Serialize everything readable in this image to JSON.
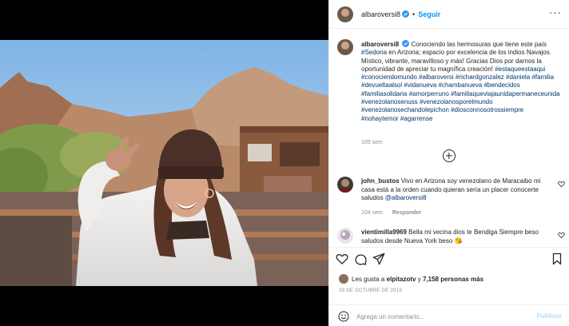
{
  "post": {
    "username": "albaroversi8",
    "follow_label": "Seguir",
    "more_icon": "more-options-icon",
    "photo_alt": "Woman in white coat and brown knit beanie making a peace sign in front of red rock mountains"
  },
  "caption": {
    "username": "albaroversi8",
    "text_plain": "Conociendo las hermosuras que tiene este país",
    "tag_sedona": "#Sedona",
    "text_after_sedona": "en Arizona; espacio por excelencia de los indios Navajos. Místico, vibrante, maravilloso y más! Gracias Dios por darnos la oportunidad de apreciar tu magnífica creación!",
    "hashtags_line": "#estaqueestaaqui #conociendomundo #albaroversi #richardgonzalez #daniela #familia #devueltaalsol #vidanueva #chambanueva #bendecidos #familiasolidaria #amorperruno #familiaqueviajaunidapermaneceunida #venezolanosenuss #venezolanosporelmundo #venezolanosechandolepichon #diosconnosotrossiempre #nohaytemor #agarrense",
    "time": "105 sem"
  },
  "comments": [
    {
      "username": "john_bustos",
      "text": "Vivo en Arizona soy venezolano de Maracaibo mi casa está a la orden cuando quieran sería un placer conocerte saludos",
      "mention": "@albaroversi8",
      "time": "104 sem",
      "reply_label": "Responder"
    },
    {
      "username": "vientimilla9969",
      "text": "Bella mi vecina dios te Bendiga Siempre beso saludos desde Nueva York beso 😘"
    }
  ],
  "actions": {
    "likes_prefix": "Les gusta a",
    "likes_user": "elpitazotv",
    "likes_connector": "y",
    "likes_count": "7,158 personas más",
    "date": "29 DE OCTUBRE DE 2019"
  },
  "add_comment": {
    "placeholder": "Agrega un comentario...",
    "publish_label": "Publicar"
  }
}
